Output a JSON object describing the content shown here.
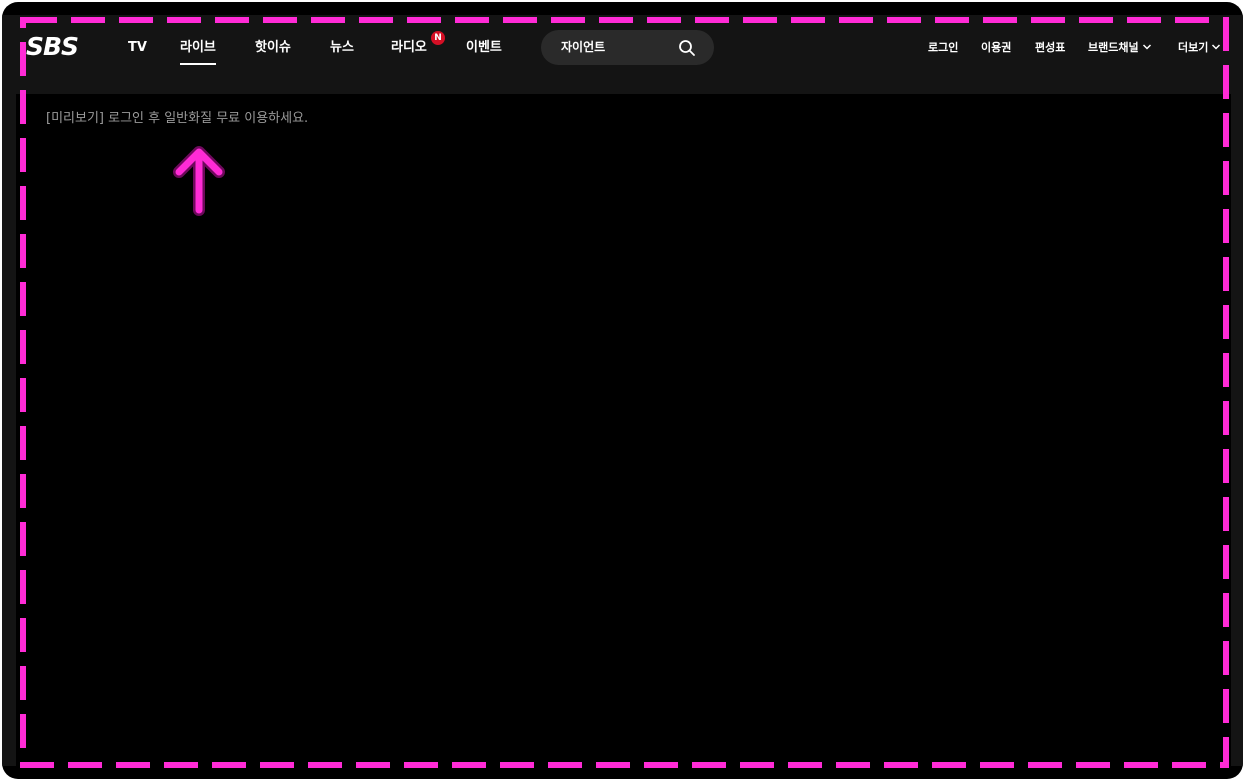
{
  "brand": {
    "logo_text": "SBS"
  },
  "nav": {
    "items": [
      {
        "label": "TV"
      },
      {
        "label": "라이브",
        "active": true
      },
      {
        "label": "핫이슈"
      },
      {
        "label": "뉴스"
      },
      {
        "label": "라디오",
        "badge": "N"
      },
      {
        "label": "이벤트"
      }
    ]
  },
  "search": {
    "value": "자이언트",
    "icon": "search-icon"
  },
  "utility": {
    "items": [
      {
        "label": "로그인"
      },
      {
        "label": "이용권"
      },
      {
        "label": "편성표"
      },
      {
        "label": "브랜드채널",
        "icon": "chevron-down-icon"
      },
      {
        "label": "더보기",
        "icon": "chevron-down-icon"
      }
    ]
  },
  "player": {
    "notice_text": "[미리보기] 로그인 후 일반화질 무료 이용하세요."
  },
  "annotation": {
    "arrow_icon": "arrow-up-icon",
    "highlight_color": "#ff2bd6"
  },
  "colors": {
    "header_bg": "#141414",
    "page_bg": "#000000",
    "badge_red": "#d50f25",
    "notice_gray": "#9a9a9a"
  }
}
